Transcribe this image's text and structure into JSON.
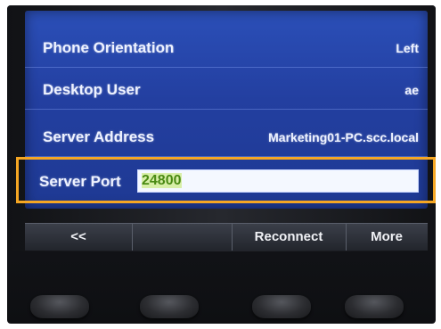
{
  "screen": {
    "rows": [
      {
        "label": "Phone Orientation",
        "value": "Left"
      },
      {
        "label": "Desktop User",
        "value": "ae"
      },
      {
        "label": "Server Address",
        "value": "Marketing01-PC.scc.local"
      }
    ],
    "server_port": {
      "label": "Server Port",
      "value": "24800"
    }
  },
  "softkeys": {
    "back": "<<",
    "reconnect": "Reconnect",
    "more": "More"
  },
  "colors": {
    "screen_blue": "#2b4fb8",
    "highlight_orange": "#f5a623",
    "input_text_green": "#4a8a14"
  }
}
